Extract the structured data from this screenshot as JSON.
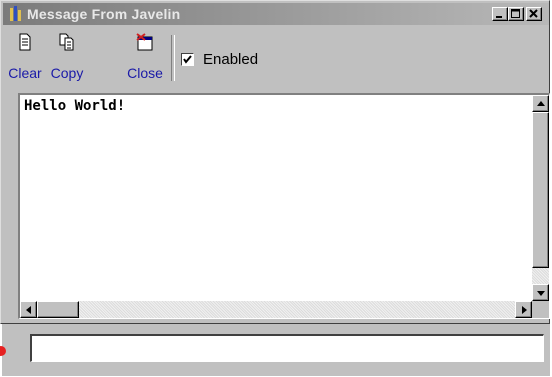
{
  "window": {
    "title": "Message From Javelin"
  },
  "title_buttons": [
    {
      "name": "minimize-button",
      "icon": "minimize-icon"
    },
    {
      "name": "maximize-button",
      "icon": "maximize-icon"
    },
    {
      "name": "close-window-button",
      "icon": "close-icon"
    }
  ],
  "toolbar": {
    "clear": {
      "label": "Clear",
      "icon": "document-icon"
    },
    "copy": {
      "label": "Copy",
      "icon": "copy-icon"
    },
    "close": {
      "label": "Close",
      "icon": "close-window-icon"
    },
    "enabled": {
      "label": "Enabled",
      "checked": true
    }
  },
  "message": {
    "text": "Hello World!"
  },
  "input": {
    "value": "",
    "placeholder": ""
  },
  "colors": {
    "accent_indicator": "#e62020",
    "title_bar": "#7b7b7b",
    "face": "#c0c0c0"
  }
}
